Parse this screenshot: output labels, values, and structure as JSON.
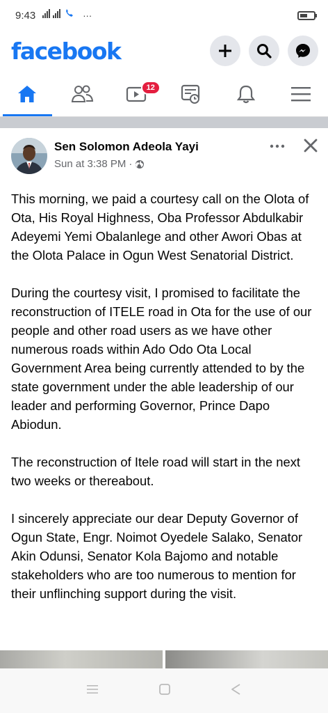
{
  "status_bar": {
    "time": "9:43",
    "signal_text": "ᵛᴸᵀᴱ",
    "overflow": "···"
  },
  "app": {
    "logo": "facebook"
  },
  "top_actions": [
    {
      "name": "create-icon"
    },
    {
      "name": "search-icon"
    },
    {
      "name": "messenger-icon"
    }
  ],
  "nav": {
    "tabs": [
      {
        "name": "home",
        "active": true
      },
      {
        "name": "friends"
      },
      {
        "name": "watch",
        "badge": "12"
      },
      {
        "name": "marketplace"
      },
      {
        "name": "notifications"
      },
      {
        "name": "menu"
      }
    ]
  },
  "post": {
    "author": "Sen Solomon Adeola Yayi",
    "timestamp": "Sun at 3:38 PM",
    "meta_separator": "·",
    "paragraphs": [
      "This morning, we paid a courtesy call on the Olota of Ota, His Royal Highness, Oba Professor Abdulkabir Adeyemi Yemi Obalanlege and other Awori Obas at the Olota Palace in Ogun West Senatorial District.",
      "During the courtesy visit, I promised to facilitate the reconstruction of ITELE road in Ota for the use of our people and other road users as we have other numerous roads within Ado Odo Ota Local Government Area being currently attended to by the state government under the able leadership of our leader and performing Governor, Prince Dapo Abiodun.",
      "The reconstruction of Itele road will start in the next two weeks or thereabout.",
      "I sincerely appreciate our dear Deputy Governor of Ogun State, Engr. Noimot Oyedele Salako, Senator Akin Odunsi, Senator Kola Bajomo and notable stakeholders who are too numerous to mention for their unflinching support during the visit."
    ]
  },
  "colors": {
    "brand": "#1877f2",
    "badge": "#e41e3f",
    "separator": "#c9ccd1"
  }
}
